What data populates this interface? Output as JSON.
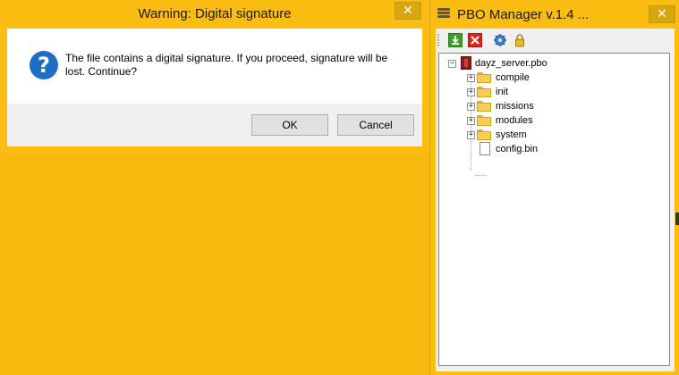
{
  "dialog": {
    "title": "Warning: Digital signature",
    "close_label": "✕",
    "message": "The file contains a digital signature. If you proceed, signature will be lost. Continue?",
    "icon": "question-icon",
    "buttons": {
      "ok": "OK",
      "cancel": "Cancel"
    }
  },
  "pbo_window": {
    "title": "PBO Manager v.1.4 ...",
    "close_label": "✕",
    "toolbar": [
      "extract-icon",
      "delete-icon",
      "settings-icon",
      "lock-icon"
    ],
    "tree": {
      "root": "dayz_server.pbo",
      "folders": [
        "compile",
        "init",
        "missions",
        "modules",
        "system"
      ],
      "files": [
        "config.bin"
      ]
    }
  },
  "colors": {
    "desktop": "#f7b90e",
    "dialog_close": "#d6a70e",
    "question_icon": "#1e6fc4"
  }
}
